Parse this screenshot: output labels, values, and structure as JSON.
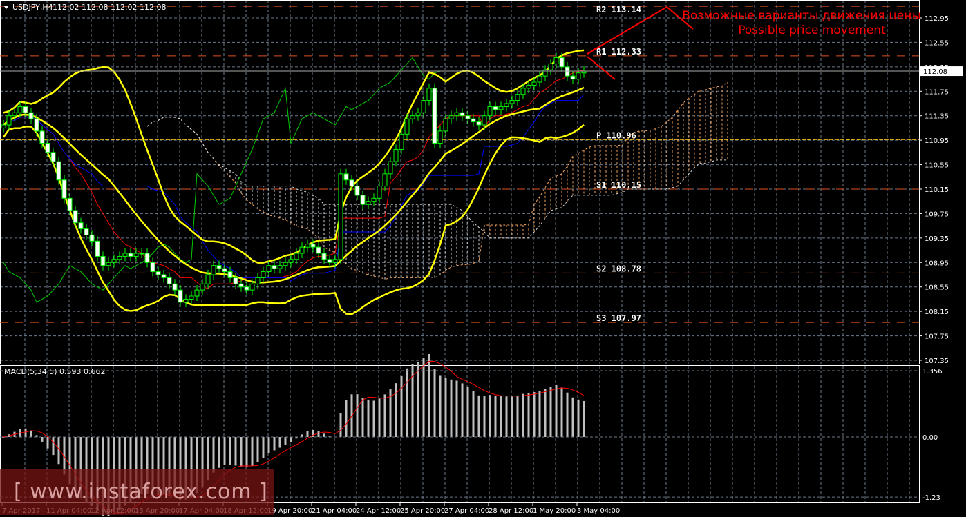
{
  "header": {
    "symbol": "USDJPY,H4",
    "ohlc": "112.02 112.08 112.02 112.08"
  },
  "macd": {
    "label": "MACD(5,34,5) 0.593 0.662",
    "fast": 5,
    "slow": 34,
    "signal": 5,
    "axis_ticks": [
      "1.356",
      "0.00",
      "-1.23"
    ],
    "axis_values": [
      1.356,
      0,
      -1.23
    ]
  },
  "price_axis": {
    "ticks": [
      "112.95",
      "112.55",
      "112.15",
      "111.75",
      "111.35",
      "110.95",
      "110.55",
      "110.15",
      "109.75",
      "109.35",
      "108.95",
      "108.55",
      "108.15",
      "107.75",
      "107.35"
    ],
    "current": "112.08",
    "current_value": 112.08
  },
  "time_axis": [
    "7 Apr 2017",
    "11 Apr 04:00",
    "12 Apr 12:00",
    "13 Apr 20:00",
    "17 Apr 04:00",
    "18 Apr 12:00",
    "19 Apr 20:00",
    "21 Apr 04:00",
    "24 Apr 12:00",
    "25 Apr 20:00",
    "27 Apr 04:00",
    "28 Apr 12:00",
    "1 May 20:00",
    "3 May 04:00"
  ],
  "pivots": [
    {
      "name": "R2",
      "value": 113.14,
      "label": "R2 113.14"
    },
    {
      "name": "R1",
      "value": 112.33,
      "label": "R1 112.33"
    },
    {
      "name": "P",
      "value": 110.96,
      "label": "P 110.96"
    },
    {
      "name": "S1",
      "value": 110.15,
      "label": "S1 110.15"
    },
    {
      "name": "S2",
      "value": 108.78,
      "label": "S2 108.78"
    },
    {
      "name": "S3",
      "value": 107.97,
      "label": "S3 107.97"
    }
  ],
  "annotation": {
    "ru": "Возможные варианты движения цены",
    "en": "Possible price movement",
    "color": "#ff0000"
  },
  "watermark": "[ www.instaforex.com ]",
  "colors": {
    "bull_outline": "#00ff00",
    "bear_body": "#ffffff",
    "bands": "#ffff00",
    "tenkan": "#ff0000",
    "kijun": "#0000ff",
    "chikou": "#00cc00",
    "cloud": "#f4a460",
    "cloud_b": "#dddddd",
    "grid": "#6b7a8a",
    "pivot": "#e05020",
    "pivot_p": "#ffcc00"
  },
  "chart_data": {
    "type": "candlestick",
    "closes": [
      111.2,
      111.35,
      111.4,
      111.5,
      111.4,
      111.3,
      111.1,
      110.9,
      110.75,
      110.6,
      110.3,
      110.0,
      109.8,
      109.6,
      109.5,
      109.4,
      109.3,
      109.05,
      108.9,
      108.95,
      109.0,
      109.05,
      109.1,
      109.05,
      109.1,
      109.1,
      108.95,
      108.8,
      108.75,
      108.7,
      108.6,
      108.5,
      108.3,
      108.35,
      108.4,
      108.5,
      108.6,
      108.75,
      108.9,
      108.85,
      108.8,
      108.7,
      108.6,
      108.55,
      108.5,
      108.6,
      108.7,
      108.8,
      108.9,
      108.85,
      108.9,
      108.95,
      109.0,
      109.1,
      109.2,
      109.25,
      109.2,
      109.1,
      109.0,
      108.95,
      109.0,
      110.4,
      110.3,
      110.2,
      110.05,
      109.9,
      109.95,
      110.0,
      110.2,
      110.4,
      110.6,
      110.8,
      111.05,
      111.3,
      111.35,
      111.4,
      111.6,
      111.8,
      110.9,
      111.1,
      111.3,
      111.35,
      111.4,
      111.35,
      111.3,
      111.25,
      111.2,
      111.35,
      111.5,
      111.45,
      111.5,
      111.55,
      111.6,
      111.7,
      111.8,
      111.85,
      111.9,
      112.0,
      112.1,
      112.2,
      112.3,
      112.15,
      112.0,
      111.95,
      112.05,
      112.08
    ],
    "ylim": [
      107.35,
      112.95
    ]
  }
}
